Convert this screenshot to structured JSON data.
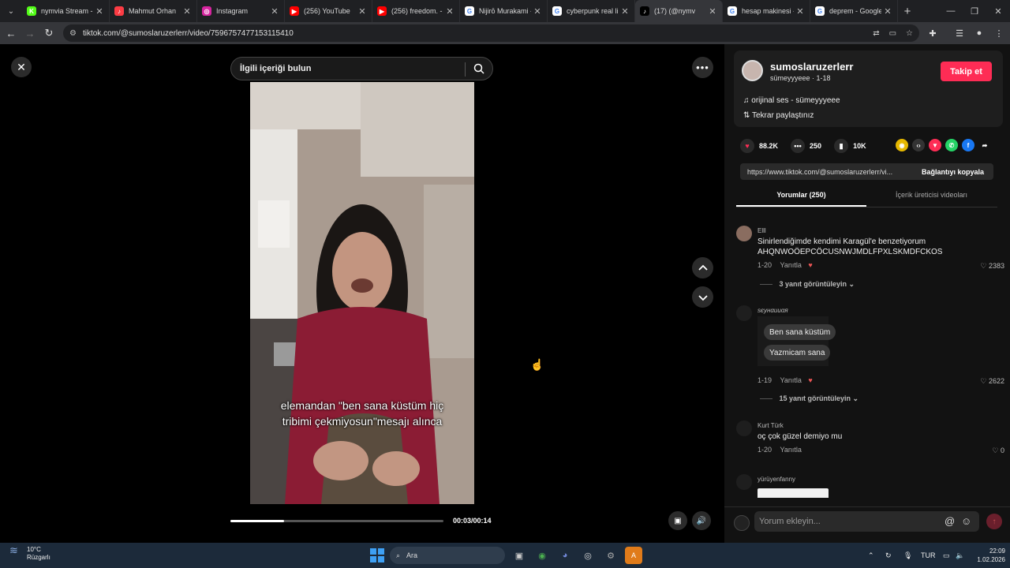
{
  "browser": {
    "tabs": [
      {
        "title": "nymvia Stream - ",
        "icon": "kick-icon",
        "color": "#53fc18",
        "glyph": "K"
      },
      {
        "title": "Mahmut Orhan",
        "icon": "music-app-icon",
        "color": "#fc3c44",
        "glyph": "♪"
      },
      {
        "title": "Instagram",
        "icon": "instagram-icon",
        "color": "#d6249f",
        "glyph": "◎"
      },
      {
        "title": "(256) YouTube",
        "icon": "youtube-icon",
        "color": "#ff0000",
        "glyph": "▶"
      },
      {
        "title": "(256) freedom. -",
        "icon": "youtube-icon",
        "color": "#ff0000",
        "glyph": "▶"
      },
      {
        "title": "Nijirō Murakami -",
        "icon": "google-icon",
        "color": "#ffffff",
        "glyph": "G"
      },
      {
        "title": "cyberpunk real li",
        "icon": "google-icon",
        "color": "#ffffff",
        "glyph": "G"
      },
      {
        "title": "(17) (@nymv",
        "icon": "tiktok-icon",
        "color": "#000000",
        "glyph": "♪",
        "active": true
      },
      {
        "title": "hesap makinesi -",
        "icon": "google-icon",
        "color": "#ffffff",
        "glyph": "G"
      },
      {
        "title": "deprem - Google",
        "icon": "google-icon",
        "color": "#ffffff",
        "glyph": "G"
      }
    ],
    "url": "tiktok.com/@sumoslaruzerlerr/video/7596757477153115410"
  },
  "video": {
    "search_placeholder": "İlgili içeriği bulun",
    "subtitle_line1": "elemandan \"ben sana küstüm hiç",
    "subtitle_line2": "tribimi çekmiyosun\"mesajı alınca",
    "time": "00:03/00:14",
    "progress": 0.25
  },
  "author": {
    "username": "sumoslaruzerlerr",
    "subline": "sümeyyyeee · 1-18",
    "follow_label": "Takip et",
    "sound": "orijinal ses - sümeyyyeee",
    "repost": "Tekrar paylaştınız"
  },
  "stats": {
    "likes": "88.2K",
    "comments": "250",
    "saves": "10K"
  },
  "link": {
    "url": "https://www.tiktok.com/@sumoslaruzerlerr/vi...",
    "copy_label": "Bağlantıyı kopyala"
  },
  "panel_tabs": {
    "comments": "Yorumlar (250)",
    "creator_videos": "İçerik üreticisi videoları"
  },
  "comments": [
    {
      "user": "Elll",
      "text": "Sinirlendiğimde kendimi Karagül'e benzetiyorum AHQNWOÖEPCÖCUSNWJMDLFPXLSKMDFCKOS",
      "date": "1-20",
      "reply": "Yanıtla",
      "likes": "2383",
      "replies": "3 yanıt görüntüleyin"
    },
    {
      "user": "ѕєунαииαя",
      "chat1": "Ben sana küstüm",
      "chat2": "Yazmicam sana",
      "date": "1-19",
      "reply": "Yanıtla",
      "likes": "2622",
      "replies": "15 yanıt görüntüleyin"
    },
    {
      "user": "Kurt Türk",
      "text": "oç çok güzel demiyo mu",
      "date": "1-20",
      "reply": "Yanıtla",
      "likes": "0"
    },
    {
      "user": "yürüyenfanny"
    }
  ],
  "comment_input": {
    "placeholder": "Yorum ekleyin..."
  },
  "taskbar": {
    "temp": "10°C",
    "weather": "Rüzgarlı",
    "search": "Ara",
    "lang": "TUR",
    "time": "22:09",
    "date": "1.02.2026"
  }
}
